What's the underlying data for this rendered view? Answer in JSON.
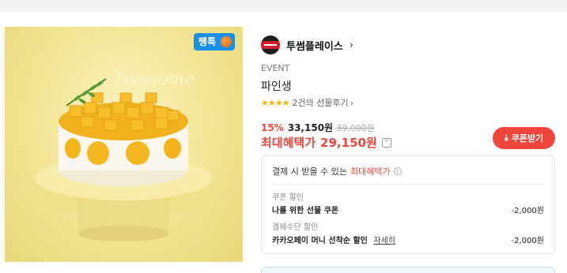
{
  "image": {
    "badge": "쨍특",
    "logo_text": "Twosome"
  },
  "brand": {
    "name": "투썸플레이스",
    "chevron": "›"
  },
  "product": {
    "event_tag": "EVENT",
    "name": "파인생",
    "stars": "★★★★",
    "review_text": "2건의 선물후기",
    "review_chevron": "›"
  },
  "price": {
    "discount": "15%",
    "sale": "33,150원",
    "original": "39,000원",
    "max_label": "최대혜택가",
    "max_price": "29,150원",
    "expand_icon": "^"
  },
  "coupon_button": {
    "icon": "⤓",
    "label": "쿠폰받기"
  },
  "benefit": {
    "title_prefix": "결제 시 받을 수 있는",
    "title_highlight": "최대혜택가",
    "info_icon": "i",
    "sections": [
      {
        "label": "쿠폰 할인",
        "item": "나를 위한 선물 쿠폰",
        "link": "",
        "amount": "-2,000원"
      },
      {
        "label": "결제수단 할인",
        "item": "카카오페이 머니 선착순 할인",
        "link": "자세히",
        "amount": "-2,000원"
      }
    ]
  },
  "colors": {
    "accent": "#f0453a",
    "badge": "#1a8fe6",
    "star": "#f6b400"
  }
}
